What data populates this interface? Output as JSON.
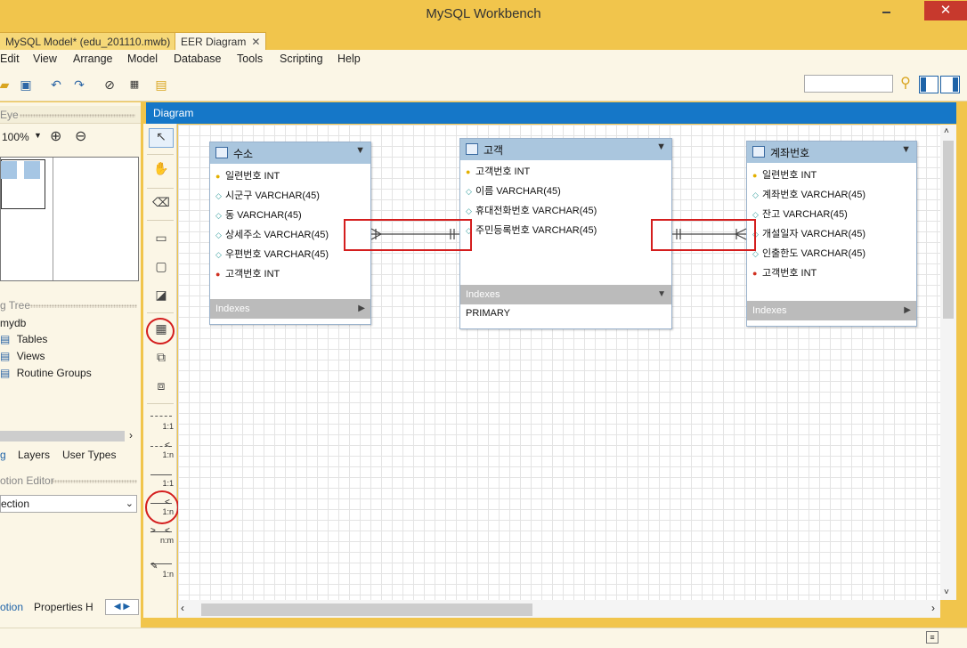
{
  "window": {
    "title": "MySQL Workbench",
    "close_glyph": "✕"
  },
  "tabs": [
    {
      "label": "MySQL Model* (edu_201110.mwb)",
      "close": "✕"
    },
    {
      "label": "EER Diagram",
      "close": "✕"
    }
  ],
  "menu": [
    "Edit",
    "View",
    "Arrange",
    "Model",
    "Database",
    "Tools",
    "Scripting",
    "Help"
  ],
  "left": {
    "birds_eye_header": "Eye",
    "zoom_value": "100%",
    "catalog_header": "g Tree",
    "tree": {
      "schema": "mydb",
      "items": [
        "Tables",
        "Views",
        "Routine Groups"
      ]
    },
    "tabs": [
      "g",
      "Layers",
      "User Types"
    ],
    "description_header": "otion Editor",
    "description_select": "ection",
    "bottom_tabs": [
      "otion",
      "Properties",
      "H"
    ]
  },
  "palette_labels": {
    "rel1": "1:1",
    "rel2": "1:n",
    "rel3": "1:1",
    "rel4": "1:n",
    "rel5": "n:m",
    "rel6": "1:n"
  },
  "diagram": {
    "header": "Diagram",
    "tables": [
      {
        "name": "수소",
        "columns": [
          {
            "icon": "pk",
            "text": "일련번호 INT"
          },
          {
            "icon": "attr",
            "text": "시군구 VARCHAR(45)"
          },
          {
            "icon": "attr",
            "text": "동 VARCHAR(45)"
          },
          {
            "icon": "attr",
            "text": "상세주소 VARCHAR(45)"
          },
          {
            "icon": "attr",
            "text": "우편번호 VARCHAR(45)"
          },
          {
            "icon": "fk",
            "text": "고객번호 INT"
          }
        ],
        "indexes_label": "Indexes",
        "indexes": []
      },
      {
        "name": "고객",
        "columns": [
          {
            "icon": "pk",
            "text": "고객번호 INT"
          },
          {
            "icon": "attr",
            "text": "이름 VARCHAR(45)"
          },
          {
            "icon": "attr",
            "text": "휴대전화번호 VARCHAR(45)"
          },
          {
            "icon": "attr",
            "text": "주민등록번호 VARCHAR(45)"
          }
        ],
        "indexes_label": "Indexes",
        "indexes": [
          "PRIMARY"
        ]
      },
      {
        "name": "계좌번호",
        "columns": [
          {
            "icon": "pk",
            "text": "일련번호 INT"
          },
          {
            "icon": "attr",
            "text": "계좌번호 VARCHAR(45)"
          },
          {
            "icon": "attr",
            "text": "잔고 VARCHAR(45)"
          },
          {
            "icon": "attr",
            "text": "개설일자 VARCHAR(45)"
          },
          {
            "icon": "attr",
            "text": "인출한도 VARCHAR(45)"
          },
          {
            "icon": "fk",
            "text": "고객번호 INT"
          }
        ],
        "indexes_label": "Indexes",
        "indexes": []
      }
    ]
  },
  "colors": {
    "titlebar": "#f1c54c",
    "diagram_header": "#1577c8",
    "table_header": "#aac6de",
    "highlight": "#d41e1e"
  }
}
